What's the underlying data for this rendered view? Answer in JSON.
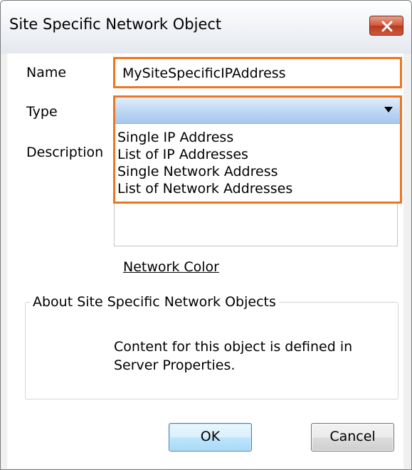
{
  "window": {
    "title": "Site Specific Network Object"
  },
  "form": {
    "name_label": "Name",
    "name_value": "MySiteSpecificIPAddress",
    "type_label": "Type",
    "type_value": "",
    "type_options": [
      "Single IP Address",
      "List of IP Addresses",
      "Single Network Address",
      "List of Network Addresses"
    ],
    "description_label": "Description",
    "description_value": "",
    "network_color_link": "Network Color"
  },
  "groupbox": {
    "title": "About Site Specific Network Objects",
    "text_line1": "Content for this object is defined in",
    "text_line2": "Server Properties."
  },
  "buttons": {
    "ok": "OK",
    "cancel": "Cancel"
  },
  "colors": {
    "highlight": "#ee7620",
    "dropdown_selected": "#bcd6f4",
    "close_button": "#d2563a"
  },
  "icons": {
    "close": "close-icon",
    "dropdown_arrow": "chevron-down-icon"
  }
}
